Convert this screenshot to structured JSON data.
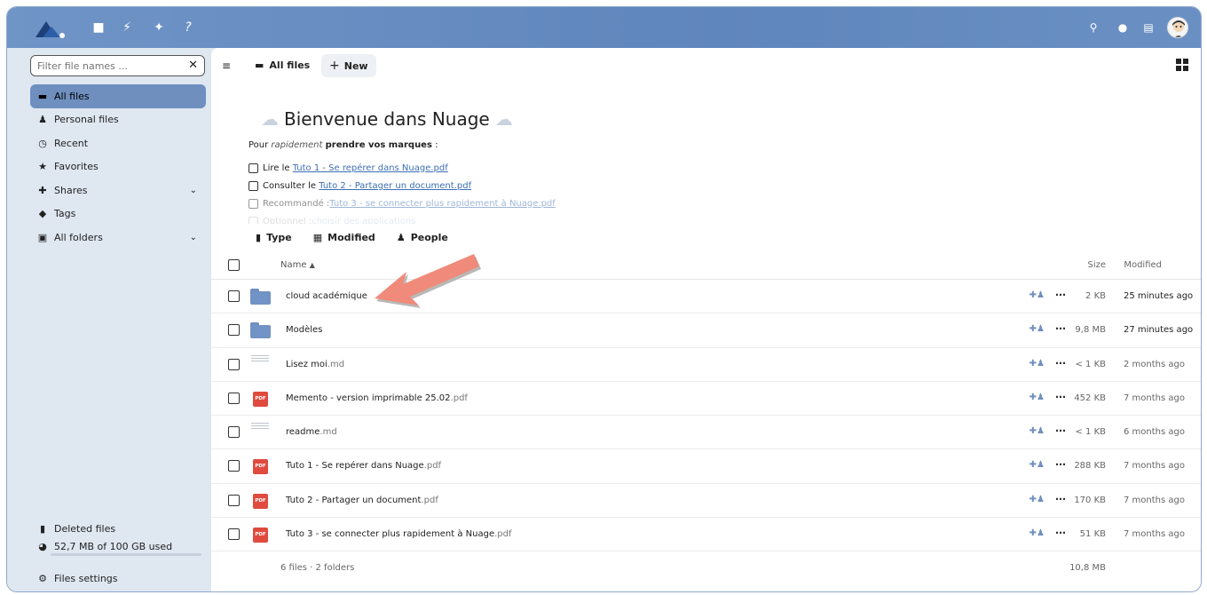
{
  "header": {
    "apps": [
      "files-icon",
      "activity-icon",
      "announcements-icon",
      "help-icon"
    ],
    "right_icons": [
      "search-icon",
      "notifications-icon",
      "contacts-icon"
    ]
  },
  "sidebar": {
    "filter_placeholder": "Filter file names ...",
    "items": [
      {
        "label": "All files",
        "icon": "folder-icon",
        "active": true
      },
      {
        "label": "Personal files",
        "icon": "person-icon"
      },
      {
        "label": "Recent",
        "icon": "history-icon"
      },
      {
        "label": "Favorites",
        "icon": "star-icon"
      },
      {
        "label": "Shares",
        "icon": "share-icon",
        "expandable": true
      },
      {
        "label": "Tags",
        "icon": "tag-icon"
      },
      {
        "label": "All folders",
        "icon": "folder-multiple-icon",
        "expandable": true
      }
    ],
    "deleted_files": "Deleted files",
    "quota": "52,7 MB of 100 GB used",
    "settings": "Files settings"
  },
  "toolbar": {
    "breadcrumb": "All files",
    "new_button": "New"
  },
  "welcome": {
    "title": "Bienvenue dans Nuage",
    "intro_prefix": "Pour ",
    "intro_italic": "rapidement",
    "intro_bold": "prendre vos marques",
    "intro_suffix": " :",
    "tasks": [
      {
        "prefix": "Lire le ",
        "link": "Tuto 1 - Se repérer dans Nuage.pdf"
      },
      {
        "prefix": "Consulter le ",
        "link": "Tuto 2 - Partager un document.pdf"
      },
      {
        "prefix": "Recommandé : ",
        "link": "Tuto 3 - se connecter plus rapidement à Nuage.pdf"
      },
      {
        "prefix": "Optionnel : ",
        "link": "choisir des applications"
      }
    ]
  },
  "filters": {
    "type": "Type",
    "modified": "Modified",
    "people": "People"
  },
  "table": {
    "col_name": "Name",
    "sort_indicator": "▲",
    "col_size": "Size",
    "col_modified": "Modified",
    "rows": [
      {
        "kind": "folder",
        "name": "cloud académique",
        "ext": "",
        "size": "2 KB",
        "modified": "25 minutes ago"
      },
      {
        "kind": "folder",
        "name": "Modèles",
        "ext": "",
        "size": "9,8 MB",
        "modified": "27 minutes ago"
      },
      {
        "kind": "text",
        "name": "Lisez moi",
        "ext": ".md",
        "size": "< 1 KB",
        "modified": "2 months ago"
      },
      {
        "kind": "pdf",
        "name": "Memento - version imprimable 25.02",
        "ext": ".pdf",
        "size": "452 KB",
        "modified": "7 months ago"
      },
      {
        "kind": "text",
        "name": "readme",
        "ext": ".md",
        "size": "< 1 KB",
        "modified": "6 months ago"
      },
      {
        "kind": "pdf",
        "name": "Tuto 1 - Se repérer dans Nuage",
        "ext": ".pdf",
        "size": "288 KB",
        "modified": "7 months ago"
      },
      {
        "kind": "pdf",
        "name": "Tuto 2 - Partager un document",
        "ext": ".pdf",
        "size": "170 KB",
        "modified": "7 months ago"
      },
      {
        "kind": "pdf",
        "name": "Tuto 3 - se connecter plus rapidement à Nuage",
        "ext": ".pdf",
        "size": "51 KB",
        "modified": "7 months ago"
      }
    ],
    "summary": "6 files · 2 folders",
    "total_size": "10,8 MB",
    "pdf_badge": "PDF"
  },
  "colors": {
    "accent": "#6f8fbf",
    "header": "#6a8fc3",
    "pdf": "#e04a3f",
    "annotation_arrow": "#f08a7a"
  }
}
